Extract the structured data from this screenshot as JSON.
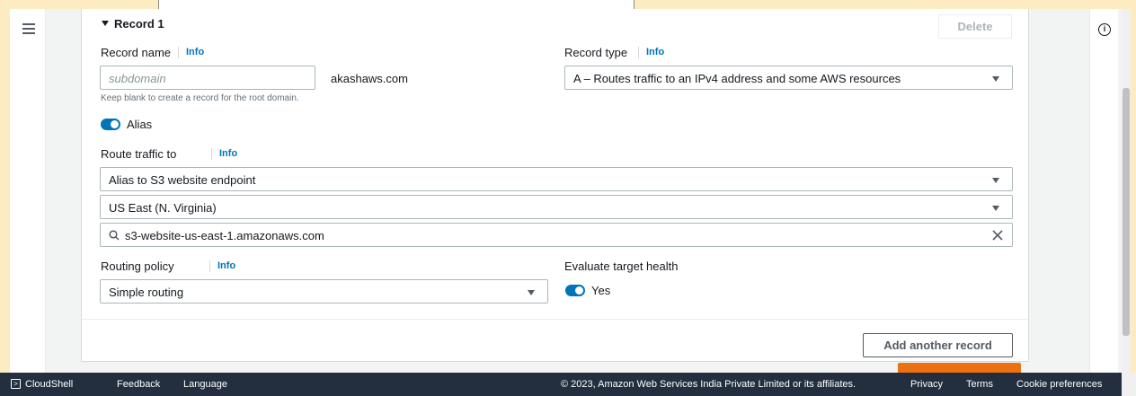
{
  "header": {
    "hamburger_icon": "hamburger-menu-icon"
  },
  "record": {
    "title": "Record 1",
    "delete_label": "Delete",
    "record_name_label": "Record name",
    "record_name_info": "Info",
    "record_name_placeholder": "subdomain",
    "record_name_value": "",
    "domain_suffix": "akashaws.com",
    "record_name_hint": "Keep blank to create a record for the root domain.",
    "record_type_label": "Record type",
    "record_type_info": "Info",
    "record_type_value": "A – Routes traffic to an IPv4 address and some AWS resources",
    "alias_label": "Alias",
    "alias_on": true,
    "route_traffic_label": "Route traffic to",
    "route_traffic_info": "Info",
    "endpoint_type": "Alias to S3 website endpoint",
    "region": "US East (N. Virginia)",
    "endpoint_value": "s3-website-us-east-1.amazonaws.com",
    "routing_policy_label": "Routing policy",
    "routing_policy_info": "Info",
    "routing_policy_value": "Simple routing",
    "eval_health_label": "Evaluate target health",
    "eval_health_value": "Yes",
    "eval_health_on": true,
    "add_another_label": "Add another record"
  },
  "footer": {
    "cloudshell": "CloudShell",
    "feedback": "Feedback",
    "language": "Language",
    "copyright": "© 2023, Amazon Web Services India Private Limited or its affiliates.",
    "privacy": "Privacy",
    "terms": "Terms",
    "cookie": "Cookie preferences"
  },
  "colors": {
    "accent": "#0073bb",
    "footer_bg": "#232f3e",
    "primary_button": "#ec7211"
  }
}
